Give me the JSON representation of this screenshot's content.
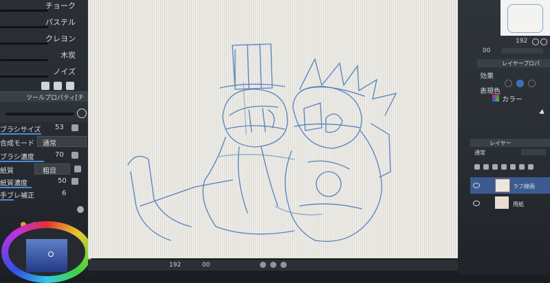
{
  "brush_list": {
    "items": [
      {
        "label": "チョーク"
      },
      {
        "label": "パステル"
      },
      {
        "label": "クレヨン"
      },
      {
        "label": "木炭"
      },
      {
        "label": "ノイズ"
      }
    ]
  },
  "tool_property": {
    "title": "ツールプロパティ[チ",
    "rows": [
      {
        "label": "ブラシサイズ",
        "value": "53"
      },
      {
        "label": "合成モード",
        "value": "通常"
      },
      {
        "label": "ブラシ濃度",
        "value": "70"
      },
      {
        "label": "紙質",
        "value": "粗目"
      },
      {
        "label": "紙質濃度",
        "value": "50"
      },
      {
        "label": "手ブレ補正",
        "value": "6"
      }
    ]
  },
  "status_bar": {
    "zoom": "192",
    "size": "00"
  },
  "navigator": {
    "zoom": "192",
    "rotation": "00"
  },
  "layer_property": {
    "title": "レイヤープロパ",
    "effect_label": "効果",
    "display_color_label": "表現色",
    "display_color_value": "カラー"
  },
  "layer_panel": {
    "title": "レイヤー",
    "blend_mode": "通常",
    "layers": [
      {
        "name": "ラフ線画"
      },
      {
        "name": "用紙"
      }
    ]
  },
  "colors": {
    "accent": "#4a8bd6",
    "sketch_line": "#3b6fb8"
  }
}
